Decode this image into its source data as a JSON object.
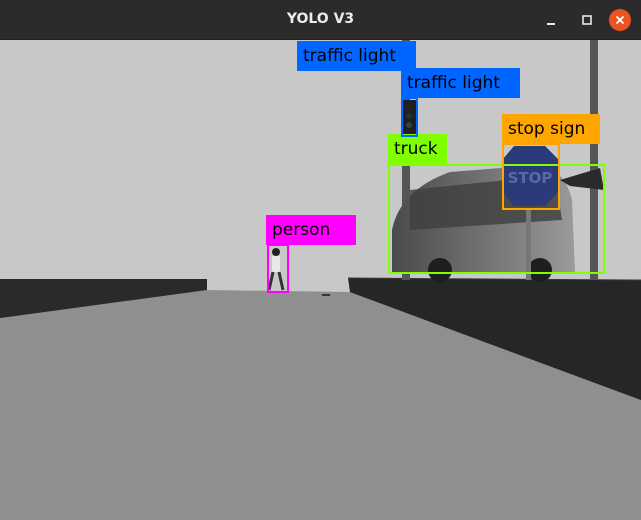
{
  "window": {
    "title": "YOLO V3",
    "controls": {
      "minimize": "minimize-icon",
      "maximize": "maximize-icon",
      "close": "close-icon"
    },
    "close_color": "#e95420"
  },
  "detections": [
    {
      "label": "traffic light",
      "color": "#0066ff"
    },
    {
      "label": "traffic light",
      "color": "#0066ff"
    },
    {
      "label": "stop  sign",
      "color": "#ffa500"
    },
    {
      "label": "truck",
      "color": "#80ff00"
    },
    {
      "label": "person",
      "color": "#ff00ff"
    }
  ],
  "scene": {
    "sign_text": "STOP"
  }
}
